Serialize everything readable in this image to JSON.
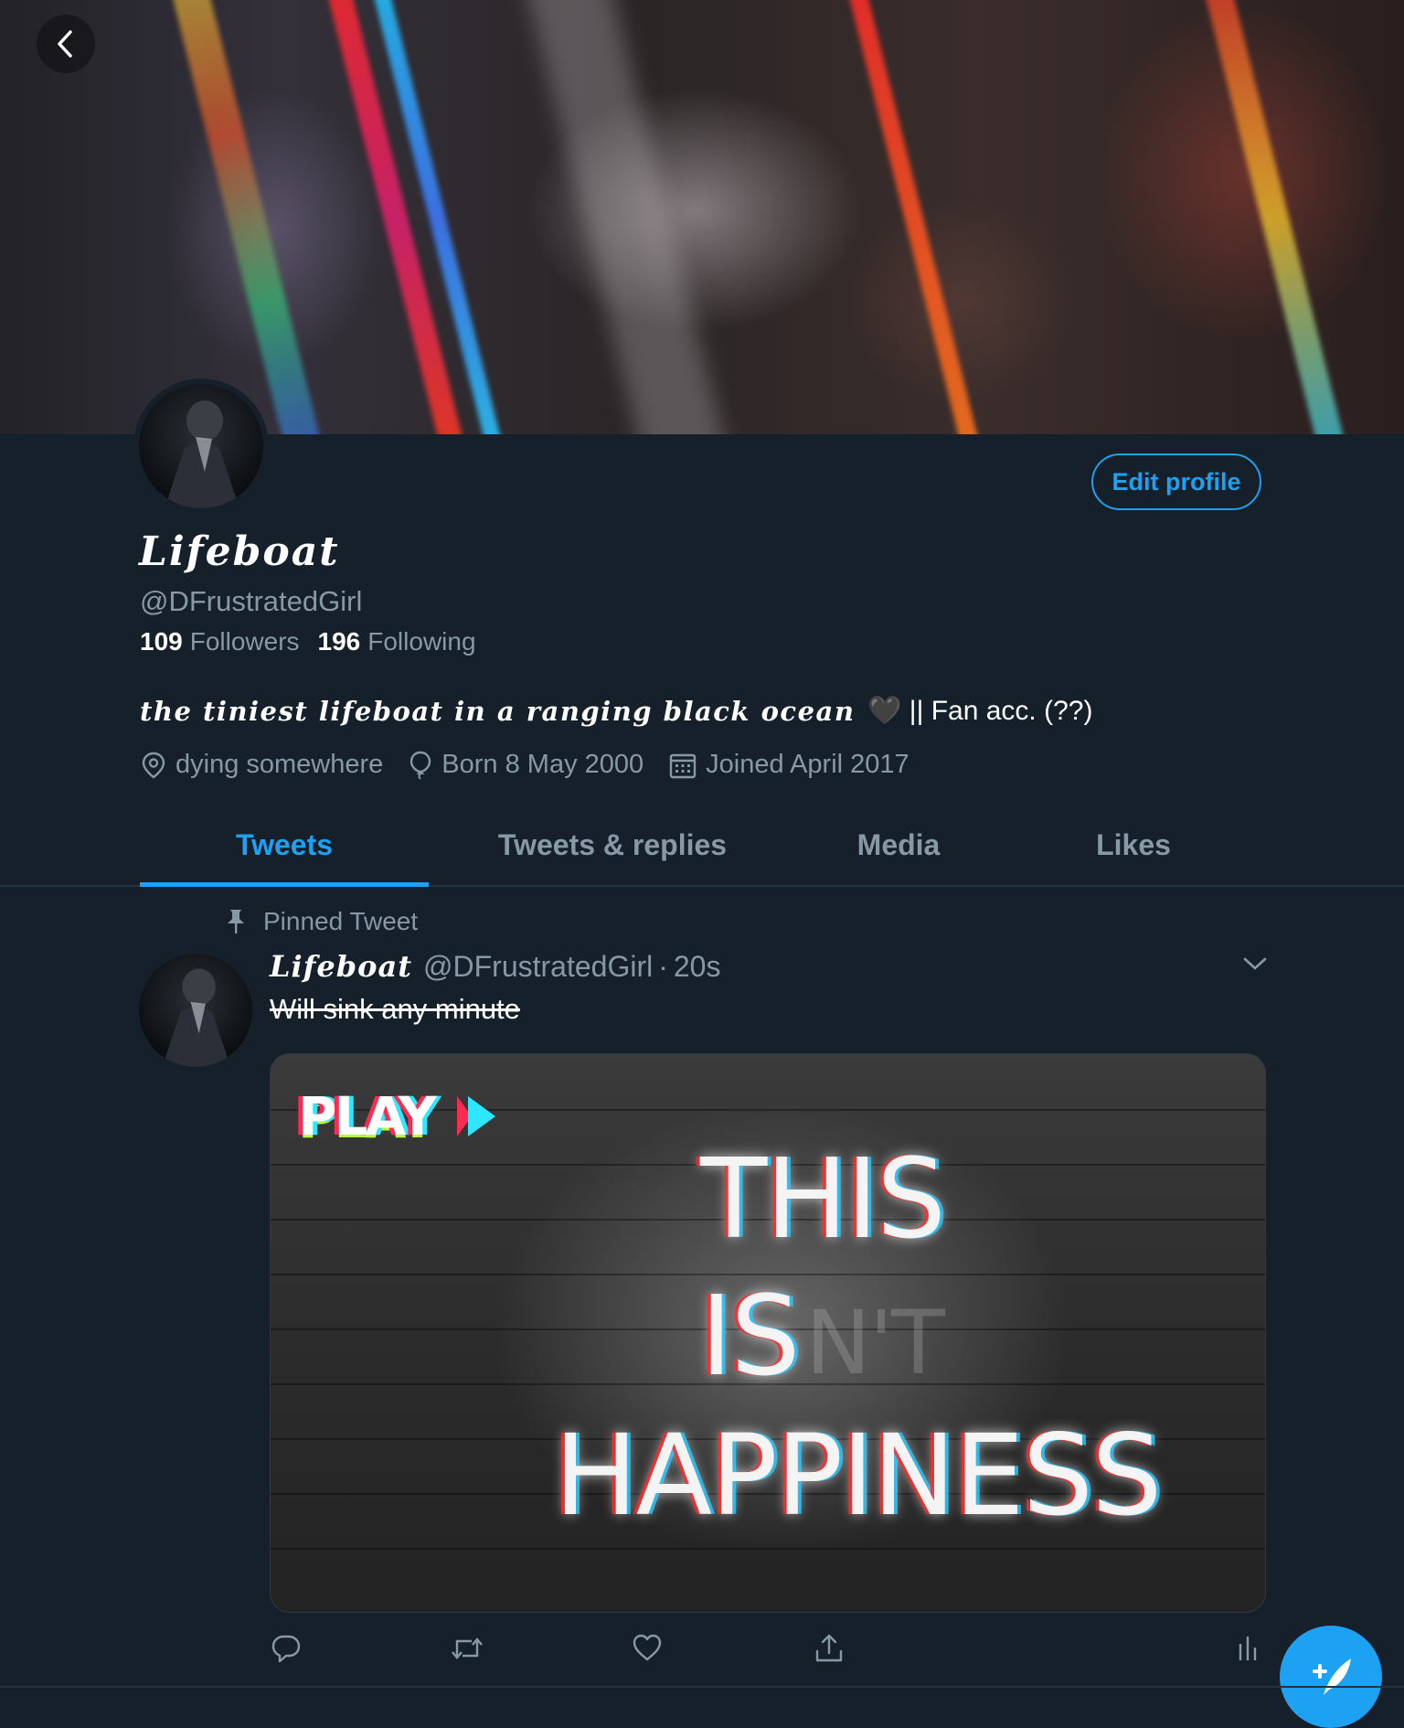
{
  "profile": {
    "display_name": "Lifeboat",
    "handle": "@DFrustratedGirl",
    "followers_count": "109",
    "followers_label": "Followers",
    "following_count": "196",
    "following_label": "Following",
    "bio_fancy": "the tiniest lifeboat in a ranging black ocean",
    "bio_heart": "🖤",
    "bio_rest": "|| Fan acc. (??)",
    "location": "dying somewhere",
    "birthday": "Born 8 May 2000",
    "joined": "Joined April 2017",
    "edit_label": "Edit profile"
  },
  "tabs": [
    {
      "label": "Tweets",
      "active": true
    },
    {
      "label": "Tweets & replies",
      "active": false
    },
    {
      "label": "Media",
      "active": false
    },
    {
      "label": "Likes",
      "active": false
    }
  ],
  "tweet": {
    "pinned_label": "Pinned Tweet",
    "author_name": "Lifeboat",
    "author_handle": "@DFrustratedGirl",
    "separator": "·",
    "time": "20s",
    "text": "Will sink any minute",
    "media": {
      "play_label": "PLAY",
      "line1": "THIS",
      "line2": "IS",
      "line2_faint": "N'T",
      "line3": "HAPPINESS"
    }
  },
  "icons": {
    "back": "chevron-left-icon",
    "location": "location-pin-icon",
    "birthday": "balloon-icon",
    "joined": "calendar-icon",
    "pin": "pin-icon",
    "reply": "reply-icon",
    "retweet": "retweet-icon",
    "like": "heart-icon",
    "share": "share-icon",
    "analytics": "analytics-icon",
    "compose": "compose-tweet-icon"
  },
  "colors": {
    "background": "#15202b",
    "accent": "#1da1f2",
    "secondary_text": "#8899a6",
    "divider": "#253341"
  }
}
